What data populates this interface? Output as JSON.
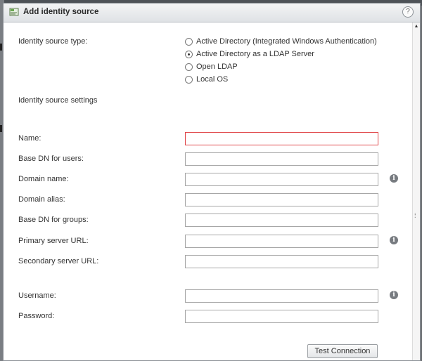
{
  "dialog": {
    "title": "Add identity source",
    "help_label": "?"
  },
  "identity_source_type": {
    "label": "Identity source type:",
    "options": [
      {
        "label": "Active Directory (Integrated Windows Authentication)",
        "checked": false
      },
      {
        "label": "Active Directory as a LDAP Server",
        "checked": true
      },
      {
        "label": "Open LDAP",
        "checked": false
      },
      {
        "label": "Local OS",
        "checked": false
      }
    ]
  },
  "settings_heading": "Identity source settings",
  "fields": {
    "name": {
      "label": "Name:",
      "value": ""
    },
    "base_dn_users": {
      "label": "Base DN for users:",
      "value": ""
    },
    "domain_name": {
      "label": "Domain name:",
      "value": ""
    },
    "domain_alias": {
      "label": "Domain alias:",
      "value": ""
    },
    "base_dn_groups": {
      "label": "Base DN for groups:",
      "value": ""
    },
    "primary_server_url": {
      "label": "Primary server URL:",
      "value": ""
    },
    "secondary_server_url": {
      "label": "Secondary server URL:",
      "value": ""
    },
    "username": {
      "label": "Username:",
      "value": ""
    },
    "password": {
      "label": "Password:",
      "value": ""
    }
  },
  "info_icon_glyph": "i",
  "test_connection_label": "Test Connection",
  "colors": {
    "error_border": "#e0474a",
    "title_bar": "#dfe2e5",
    "info_icon": "#777b80"
  }
}
